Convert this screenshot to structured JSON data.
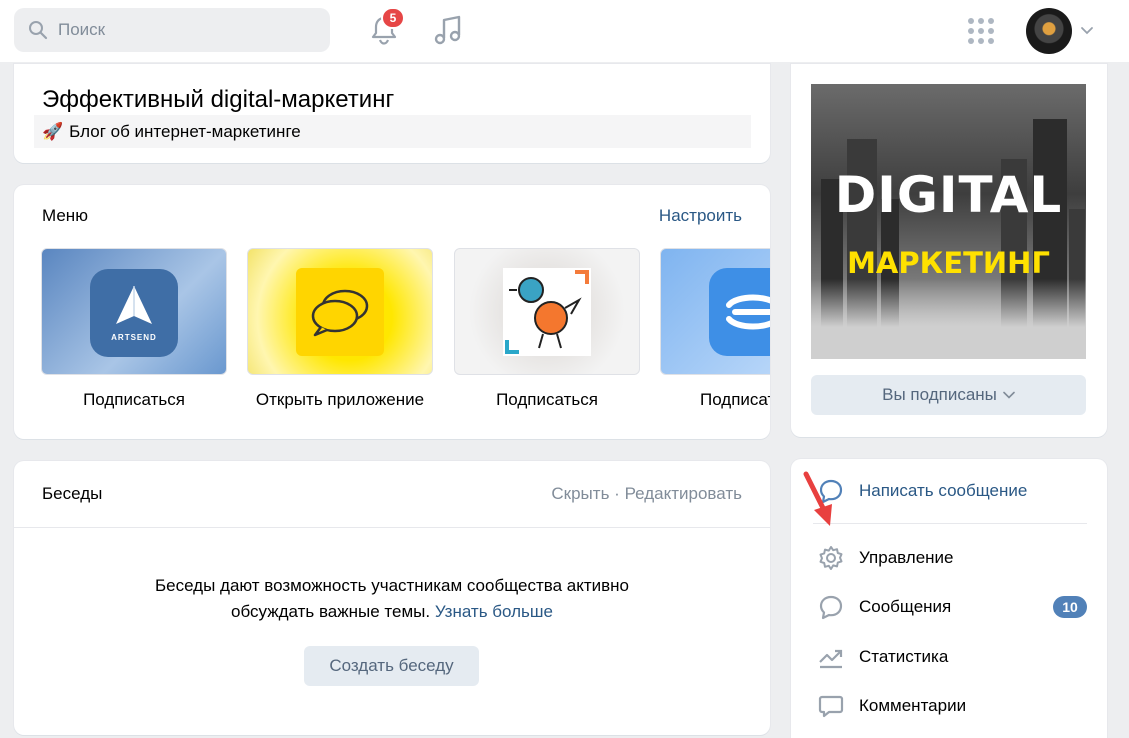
{
  "header": {
    "search_placeholder": "Поиск",
    "notifications_count": "5"
  },
  "group": {
    "title": "Эффективный digital-маркетинг",
    "status_emoji": "🚀",
    "status": "Блог об интернет-маркетинге"
  },
  "menu": {
    "heading": "Меню",
    "configure_link": "Настроить",
    "tiles": [
      {
        "label": "Подписаться",
        "app": "ARTSEND"
      },
      {
        "label": "Открыть приложение"
      },
      {
        "label": "Подписаться"
      },
      {
        "label": "Подписаться"
      }
    ]
  },
  "chats": {
    "heading": "Беседы",
    "hide_link": "Скрыть",
    "separator": "·",
    "edit_link": "Редактировать",
    "text_line1": "Беседы дают возможность участникам сообщества активно",
    "text_line2": "обсуждать важные темы.",
    "learn_more": "Узнать больше",
    "create_button": "Создать беседу"
  },
  "cover": {
    "line1": "DIGITAL",
    "line2": "МАРКЕТИНГ"
  },
  "subscribe": {
    "button": "Вы подписаны"
  },
  "actions": [
    {
      "label": "Написать сообщение",
      "icon": "message-bubble-icon"
    },
    {
      "label": "Управление",
      "icon": "gear-icon"
    },
    {
      "label": "Сообщения",
      "icon": "chat-bubble-icon",
      "badge": "10"
    },
    {
      "label": "Статистика",
      "icon": "trend-chart-icon"
    },
    {
      "label": "Комментарии",
      "icon": "comment-icon"
    }
  ],
  "colors": {
    "link": "#2a5885",
    "accent_badge": "#5181b8",
    "notification_badge": "#e64646",
    "annotation_arrow": "#e8403f",
    "background": "#edeef0"
  }
}
